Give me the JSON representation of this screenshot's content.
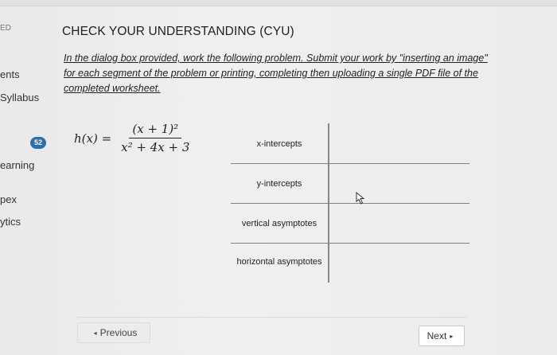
{
  "sidebar": {
    "top_label": "ED",
    "items": [
      {
        "label": "ents"
      },
      {
        "label": "Syllabus"
      },
      {
        "label": "earning"
      },
      {
        "label": "pex"
      },
      {
        "label": "ytics"
      }
    ],
    "badge": "52"
  },
  "content": {
    "heading": "CHECK YOUR UNDERSTANDING (CYU)",
    "instructions": "In the dialog box provided, work the following problem. Submit your work by \"inserting an image\" for each segment of the problem or printing, completing then uploading a single PDF file of the completed worksheet.",
    "formula": {
      "lhs": "h(x) =",
      "numerator": "(x + 1)²",
      "denominator": "x² + 4x + 3"
    },
    "table_rows": [
      {
        "label": "x-intercepts"
      },
      {
        "label": "y-intercepts"
      },
      {
        "label": "vertical asymptotes"
      },
      {
        "label": "horizontal asymptotes"
      }
    ]
  },
  "navigation": {
    "previous_label": "Previous",
    "next_label": "Next"
  },
  "icons": {
    "prev_caret": "caret-left-icon",
    "next_caret": "caret-right-icon",
    "cursor": "mouse-pointer-icon"
  },
  "colors": {
    "badge": "#2f6fa6"
  }
}
